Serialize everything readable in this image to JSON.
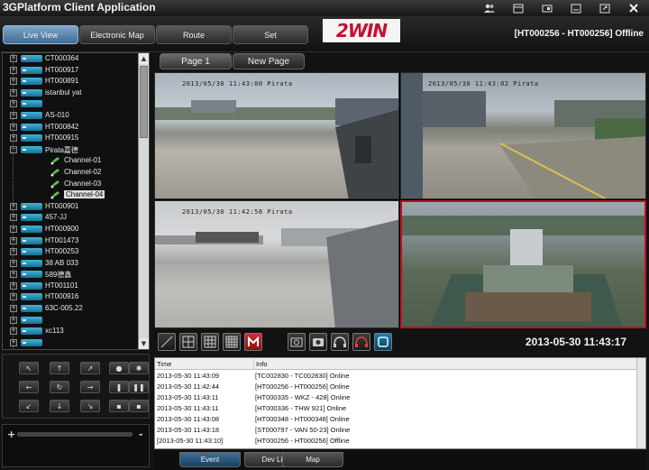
{
  "app": {
    "title": "3GPlatform Client Application",
    "device_status": "[HT000256 - HT000256] Offline"
  },
  "logo_text": "2WIN",
  "nav": {
    "buttons": [
      "Live View",
      "Electronic Map",
      "Route",
      "Set"
    ]
  },
  "pages": [
    "Page 1",
    "New Page"
  ],
  "tree": [
    {
      "label": "CT000364"
    },
    {
      "label": "HT000917"
    },
    {
      "label": "HT000891"
    },
    {
      "label": "istanbul yat"
    },
    {
      "label": ""
    },
    {
      "label": "AS-010"
    },
    {
      "label": "HT000842"
    },
    {
      "label": "HT000915"
    },
    {
      "label": "Pirata嘉德"
    },
    {
      "label": "Channel-01",
      "channel": true
    },
    {
      "label": "Channel-02",
      "channel": true
    },
    {
      "label": "Channel-03",
      "channel": true
    },
    {
      "label": "Channel-04",
      "channel": true,
      "selected": true
    },
    {
      "label": "HT000901"
    },
    {
      "label": "457-JJ"
    },
    {
      "label": "HT000900"
    },
    {
      "label": "HT001473"
    },
    {
      "label": "HT000253"
    },
    {
      "label": "38 AB 033"
    },
    {
      "label": "589德鑫"
    },
    {
      "label": "HT001101"
    },
    {
      "label": "HT000916"
    },
    {
      "label": "63C-005.22"
    },
    {
      "label": ""
    },
    {
      "label": "xc113"
    },
    {
      "label": ""
    }
  ],
  "video": {
    "cells": [
      {
        "osd": "2013/05/30  11:43:00  Pirata"
      },
      {
        "osd": "2013/05/30  11:43:02  Pirata"
      },
      {
        "osd": "2013/05/30  11:42:58  Pirata"
      },
      {
        "osd": ""
      }
    ]
  },
  "toolbar": {
    "datetime": "2013-05-30 11:43:17"
  },
  "log": {
    "headers": {
      "time": "Time",
      "info": "Info"
    },
    "rows": [
      {
        "time": "2013-05-30 11:43:09",
        "info": "[TC002830 - TC002830] Online"
      },
      {
        "time": "2013-05-30 11:42:44",
        "info": "[HT000256 - HT000256] Online"
      },
      {
        "time": "2013-05-30 11:43:11",
        "info": "[HT000335 - WKZ - 428] Online"
      },
      {
        "time": "2013-05-30 11:43:11",
        "info": "[HT000336 - THW 921] Online"
      },
      {
        "time": "2013-05-30 11:43:08",
        "info": "[HT000348 - HT000348] Online"
      },
      {
        "time": "2013-05-30 11:43:18",
        "info": "[ST000797 - VAN 50-23] Online"
      },
      {
        "time": "[2013-05-30 11:43:10]",
        "info": "[HT000256 - HT000256] Offline"
      }
    ]
  },
  "bottom_tabs": [
    "Event",
    "Dev List",
    "Map"
  ],
  "zoom": {
    "minus": "-",
    "plus": "+"
  }
}
